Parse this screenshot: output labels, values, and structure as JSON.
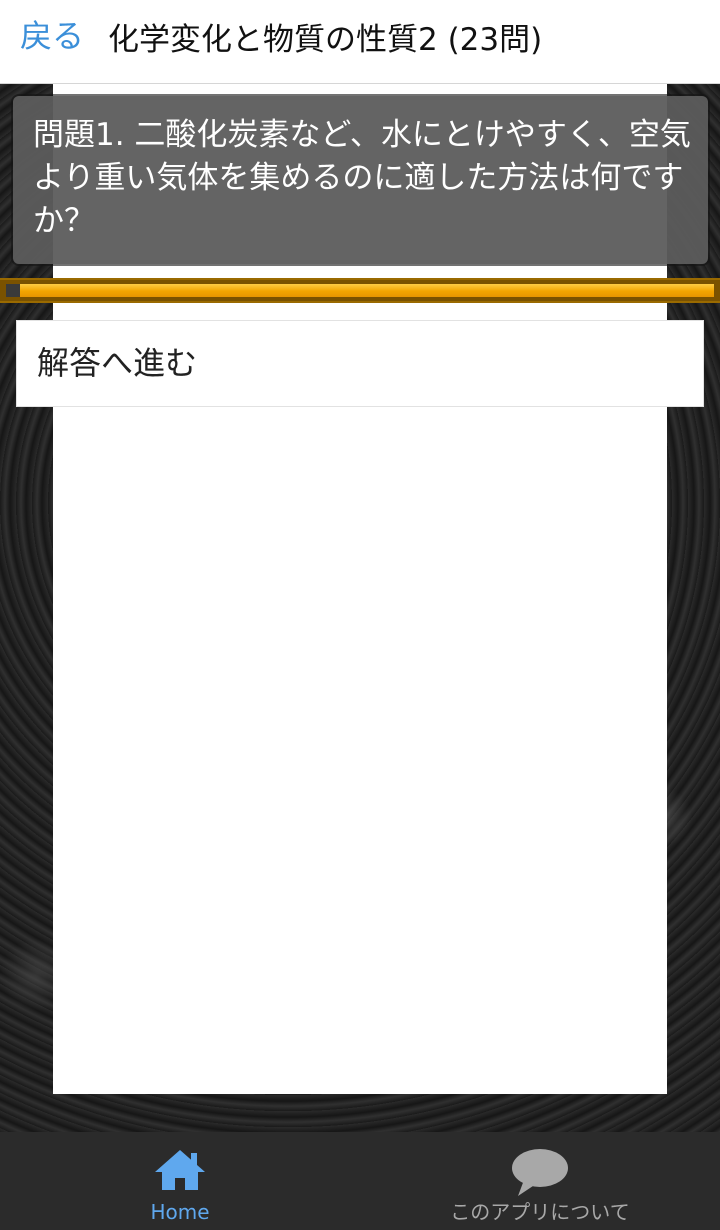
{
  "header": {
    "back_label": "戻る",
    "title": "化学変化と物質の性質2 (23問)"
  },
  "question": {
    "text": "問題1. 二酸化炭素など、水にとけやすく、空気より重い気体を集めるのに適した方法は何ですか？"
  },
  "progress": {
    "fraction": 0.98
  },
  "answer_button": {
    "label": "解答へ進む"
  },
  "bottom_nav": {
    "items": [
      {
        "label": "Home",
        "icon": "home-icon",
        "active": true
      },
      {
        "label": "このアプリについて",
        "icon": "speech-bubble-icon",
        "active": false
      }
    ]
  },
  "colors": {
    "accent": "#3b8fd9",
    "progress": "#f3a500",
    "nav_active": "#5fa8ee",
    "nav_inactive": "#a8a8a8"
  }
}
